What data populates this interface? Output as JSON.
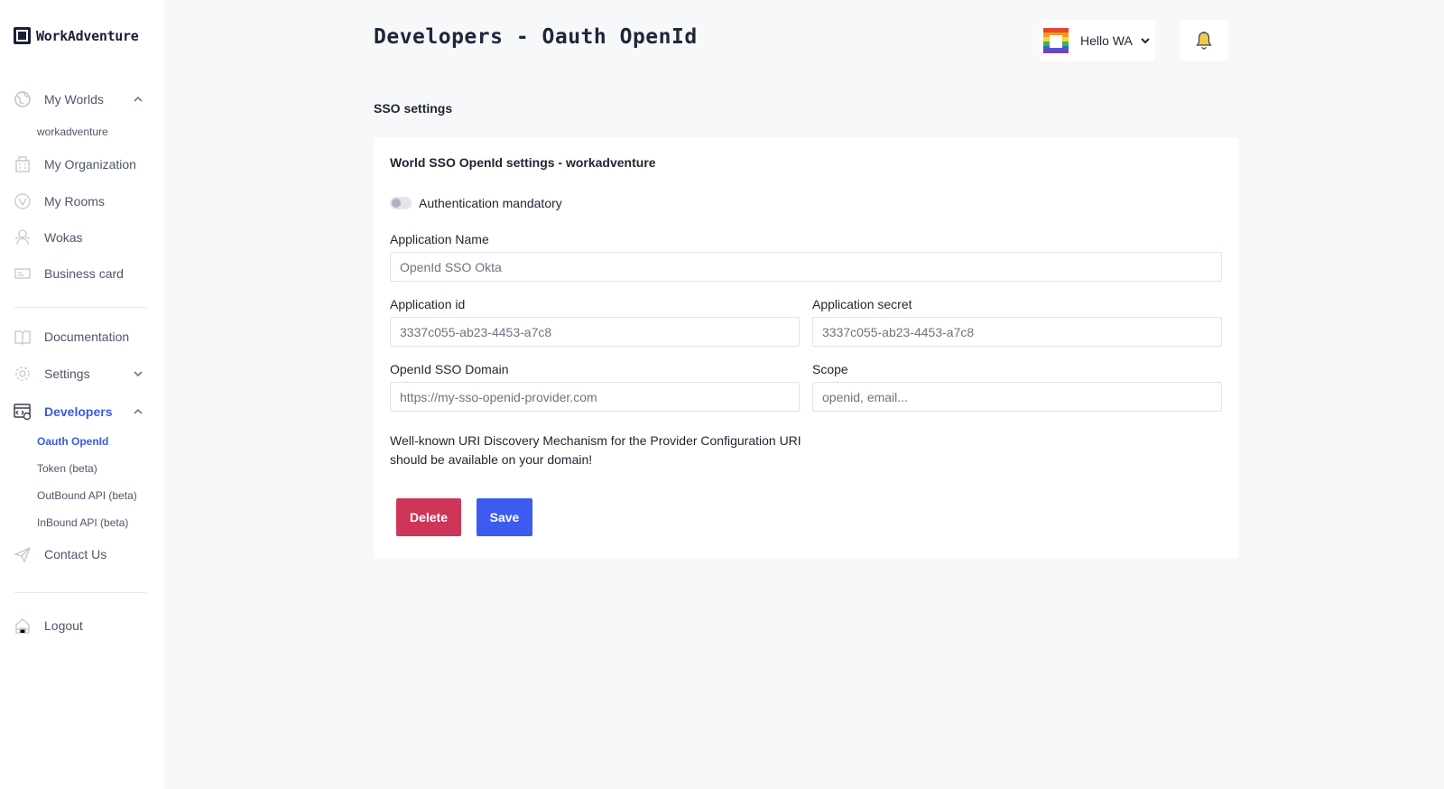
{
  "app": {
    "name": "WorkAdventure"
  },
  "sidebar": {
    "items": [
      {
        "label": "My Worlds",
        "icon": "globe-icon"
      },
      {
        "label": "My Organization",
        "icon": "building-icon"
      },
      {
        "label": "My Rooms",
        "icon": "rooms-icon"
      },
      {
        "label": "Wokas",
        "icon": "woka-icon"
      },
      {
        "label": "Business card",
        "icon": "card-icon"
      },
      {
        "label": "Documentation",
        "icon": "book-icon"
      },
      {
        "label": "Settings",
        "icon": "gear-icon"
      },
      {
        "label": "Developers",
        "icon": "developer-icon"
      },
      {
        "label": "Contact Us",
        "icon": "paper-plane-icon"
      },
      {
        "label": "Logout",
        "icon": "logout-icon"
      }
    ],
    "worlds_sub": [
      "workadventure"
    ],
    "developers_sub": [
      "Oauth OpenId",
      "Token (beta)",
      "OutBound API (beta)",
      "InBound API (beta)"
    ],
    "active_sub": "Oauth OpenId"
  },
  "header": {
    "title": "Developers - Oauth OpenId",
    "user_name": "Hello WA"
  },
  "main": {
    "section_title": "SSO settings",
    "card_title": "World SSO OpenId settings - workadventure",
    "toggle_label": "Authentication mandatory",
    "toggle_on": false,
    "fields": {
      "app_name": {
        "label": "Application Name",
        "placeholder": "OpenId SSO Okta"
      },
      "app_id": {
        "label": "Application id",
        "placeholder": "3337c055-ab23-4453-a7c8"
      },
      "app_secret": {
        "label": "Application secret",
        "placeholder": "3337c055-ab23-4453-a7c8"
      },
      "domain": {
        "label": "OpenId SSO Domain",
        "placeholder": "https://my-sso-openid-provider.com"
      },
      "scope": {
        "label": "Scope",
        "placeholder": "openid, email..."
      }
    },
    "note": "Well-known URI Discovery Mechanism for the Provider Configuration URI should be available on your domain!",
    "delete_label": "Delete",
    "save_label": "Save"
  },
  "colors": {
    "accent": "#3d5bf0",
    "danger": "#cf3558",
    "active_nav": "#3b5bdb"
  }
}
